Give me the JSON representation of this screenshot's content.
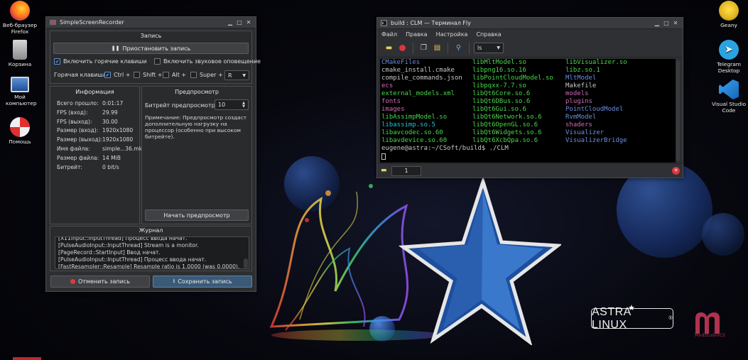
{
  "desktop": {
    "icons": [
      {
        "label": "Веб-браузер Firefox"
      },
      {
        "label": "Корзина"
      },
      {
        "label": "Мой компьютер"
      },
      {
        "label": "Помощь"
      },
      {
        "label": "Geany"
      },
      {
        "label": "Telegram Desktop"
      },
      {
        "label": "Visual Studio Code"
      }
    ],
    "brand": {
      "astra": "ASTRA LINUX",
      "reg": "®",
      "m_caption": "ModStudioCS"
    }
  },
  "ssr": {
    "title": "SimpleScreenRecorder",
    "record_group": "Запись",
    "pause_button": "Приостановить запись",
    "hotkeys_checkbox": "Включить горячие клавиши",
    "sound_checkbox": "Включить звуковое оповещение",
    "hotkey_label": "Горячая клавиша:",
    "mod_ctrl": "Ctrl +",
    "mod_shift": "Shift +",
    "mod_alt": "Alt +",
    "mod_super": "Super +",
    "key_value": "R",
    "info": {
      "title": "Информация",
      "rows": [
        {
          "k": "Всего прошло:",
          "v": "0:01:17"
        },
        {
          "k": "FPS (вход):",
          "v": "29.99"
        },
        {
          "k": "FPS (выход):",
          "v": "30.00"
        },
        {
          "k": "Размер (вход):",
          "v": "1920x1080"
        },
        {
          "k": "Размер (выход):",
          "v": "1920x1080"
        },
        {
          "k": "Имя файла:",
          "v": "simple...36.mkv"
        },
        {
          "k": "Размер файла:",
          "v": "14 MiB"
        },
        {
          "k": "Битрейт:",
          "v": "0 bit/s"
        }
      ]
    },
    "preview": {
      "title": "Предпросмотр",
      "bitrate_label": "Битрейт предпросмотра:",
      "bitrate_value": "10",
      "note": "Примечание: Предпросмотр создаст дополнительную нагрузку на процессор (особенно при высоком битрейте).",
      "start_button": "Начать предпросмотр"
    },
    "log": {
      "title": "Журнал",
      "lines": [
        "[X11Input::InputThread] Процесс ввода начат.",
        "[PulseAudioInput::InputThread] Stream is a monitor.",
        "[PageRecord::StartInput] Ввод начат.",
        "[PulseAudioInput::InputThread] Процесс ввода начат.",
        "[FastResampler::Resample] Resample ratio is 1.0000 (was 0.0000)."
      ]
    },
    "cancel_button": "Отменить запись",
    "save_button": "Сохранить запись"
  },
  "terminal": {
    "title": "build : CLM — Терминал Fly",
    "menu": [
      "Файл",
      "Правка",
      "Настройка",
      "Справка"
    ],
    "command_combo": "ls",
    "tab_number": "1",
    "col1": [
      {
        "t": "CMakeFiles",
        "c": "dir"
      },
      {
        "t": "cmake_install.cmake",
        "c": "file"
      },
      {
        "t": "compile_commands.json",
        "c": "file"
      },
      {
        "t": "ecs",
        "c": "pink"
      },
      {
        "t": "external_models.xml",
        "c": "exe"
      },
      {
        "t": "fonts",
        "c": "pink"
      },
      {
        "t": "images",
        "c": "pink"
      },
      {
        "t": "libAssimpModel.so",
        "c": "exe"
      },
      {
        "t": "libassimp.so.5",
        "c": "link"
      },
      {
        "t": "libavcodec.so.60",
        "c": "exe"
      },
      {
        "t": "libavdevice.so.60",
        "c": "exe"
      }
    ],
    "col2": [
      {
        "t": "libMltModel.so",
        "c": "exe"
      },
      {
        "t": "libpng16.so.16",
        "c": "exe"
      },
      {
        "t": "libPointCloudModel.so",
        "c": "exe"
      },
      {
        "t": "libpqxx-7.7.so",
        "c": "exe"
      },
      {
        "t": "libQt6Core.so.6",
        "c": "exe"
      },
      {
        "t": "libQt6DBus.so.6",
        "c": "exe"
      },
      {
        "t": "libQt6Gui.so.6",
        "c": "exe"
      },
      {
        "t": "libQt6Network.so.6",
        "c": "exe"
      },
      {
        "t": "libQt6OpenGL.so.6",
        "c": "exe"
      },
      {
        "t": "libQt6Widgets.so.6",
        "c": "exe"
      },
      {
        "t": "libQt6XcbQpa.so.6",
        "c": "exe"
      }
    ],
    "col3": [
      {
        "t": "libVisualizer.so",
        "c": "exe"
      },
      {
        "t": "libz.so.1",
        "c": "exe"
      },
      {
        "t": "MltModel",
        "c": "dir"
      },
      {
        "t": "Makefile",
        "c": "file"
      },
      {
        "t": "models",
        "c": "pink"
      },
      {
        "t": "plugins",
        "c": "pink"
      },
      {
        "t": "PointCloudModel",
        "c": "dir"
      },
      {
        "t": "RvmModel",
        "c": "dir"
      },
      {
        "t": "shaders",
        "c": "pink"
      },
      {
        "t": "Visualizer",
        "c": "dir"
      },
      {
        "t": "VisualizerBridge",
        "c": "dir"
      }
    ],
    "prompt": "eugene@astra:~/CSoft/build$ ./CLM"
  },
  "colors": {
    "ssr_primary": "#3b5a78",
    "term_dir": "#6b8de0",
    "term_exe": "#4cd64c",
    "term_pink": "#d36ab8",
    "term_link": "#27c3d3"
  }
}
